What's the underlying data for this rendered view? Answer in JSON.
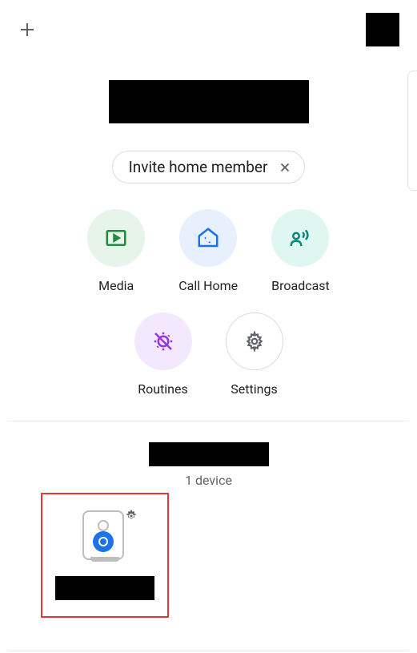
{
  "topbar": {
    "add_icon": "plus-icon",
    "account_icon": "account-avatar"
  },
  "home": {
    "title": "█████████",
    "invite_label": "Invite home member"
  },
  "actions": {
    "media": {
      "label": "Media"
    },
    "call_home": {
      "label": "Call Home"
    },
    "broadcast": {
      "label": "Broadcast"
    },
    "routines": {
      "label": "Routines"
    },
    "settings": {
      "label": "Settings"
    }
  },
  "room": {
    "name": "█████████",
    "device_count_label": "1 device"
  },
  "device": {
    "name": "█████████"
  }
}
